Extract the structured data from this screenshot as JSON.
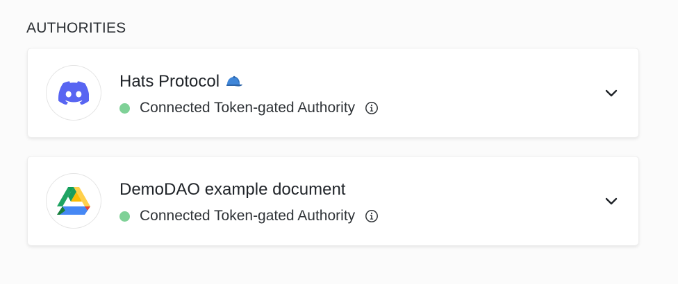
{
  "section": {
    "title": "AUTHORITIES"
  },
  "authorities": [
    {
      "name": "Hats Protocol",
      "title_icon": "cap-icon",
      "logo": "discord-logo",
      "status_text": "Connected Token-gated Authority",
      "status_color": "#7fd197",
      "info_icon": "info-icon",
      "expand_icon": "chevron-down-icon"
    },
    {
      "name": "DemoDAO example document",
      "logo": "google-drive-logo",
      "status_text": "Connected Token-gated Authority",
      "status_color": "#7fd197",
      "info_icon": "info-icon",
      "expand_icon": "chevron-down-icon"
    }
  ],
  "colors": {
    "discord": "#5865f2",
    "status_connected": "#7fd197"
  }
}
